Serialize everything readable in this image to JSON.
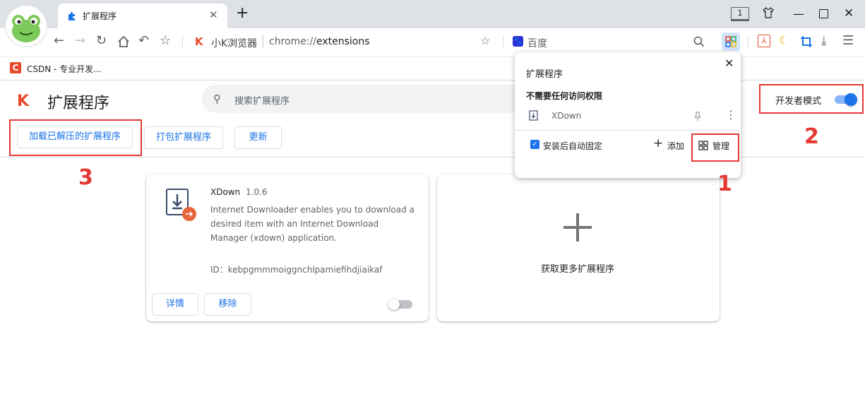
{
  "browser": {
    "tab_title": "扩展程序",
    "tab_count": "1",
    "brand": "小K浏览器",
    "url_scheme": "chrome://",
    "url_path": "extensions",
    "search_engine": "百度"
  },
  "bookmarks": {
    "items": [
      {
        "icon": "C",
        "label": "CSDN - 专业开发..."
      }
    ]
  },
  "page": {
    "title": "扩展程序",
    "search_placeholder": "搜索扩展程序",
    "dev_mode_label": "开发者模式",
    "dev_mode_on": true
  },
  "toolbar": {
    "load_unpacked": "加载已解压的扩展程序",
    "pack": "打包扩展程序",
    "update": "更新"
  },
  "extension": {
    "name": "XDown",
    "version": "1.0.6",
    "description": "Internet Downloader enables you to download a desired item with an Internet Download Manager (xdown) application.",
    "id_text": "ID：kebpgmmmoiggnchlpamiefihdjiaikaf",
    "details": "详情",
    "remove": "移除",
    "enabled": false
  },
  "get_more": "获取更多扩展程序",
  "popup": {
    "title": "扩展程序",
    "section": "不需要任何访问权限",
    "ext_name": "XDown",
    "auto_pin_label": "安装后自动固定",
    "add": "添加",
    "manage": "管理"
  },
  "annotations": [
    "1",
    "2",
    "3"
  ],
  "colors": {
    "accent": "#1a73e8",
    "annotation": "#e53935",
    "brand": "#e8492b"
  }
}
